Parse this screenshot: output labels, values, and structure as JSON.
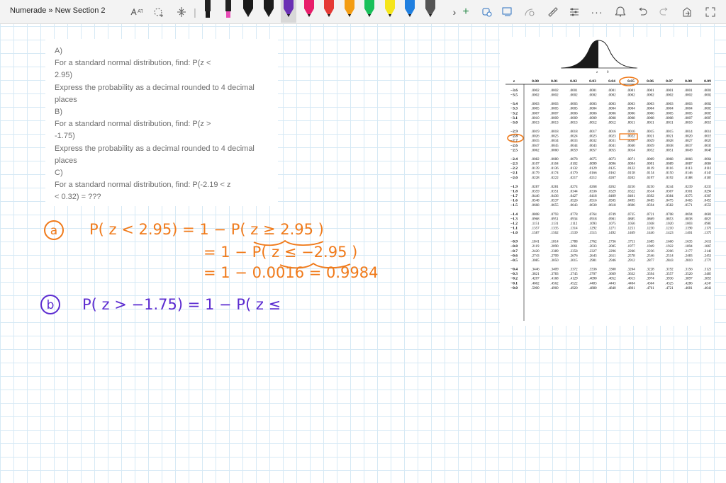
{
  "toolbar": {
    "breadcrumb": "Numerade » New Section 2",
    "tools": [
      "lasso-select-icon",
      "add-space-icon",
      "insert-space-icon"
    ],
    "pens": [
      {
        "name": "pen-black",
        "color": "#1a1a1a"
      },
      {
        "name": "highlighter-pink",
        "color": "#e84cb6"
      },
      {
        "name": "pen-black-2",
        "color": "#1a1a1a"
      },
      {
        "name": "pen-black-3",
        "color": "#1a1a1a"
      },
      {
        "name": "pen-purple",
        "color": "#6a2fb4"
      },
      {
        "name": "pen-pink",
        "color": "#e81d6a"
      },
      {
        "name": "pen-red",
        "color": "#e53935"
      },
      {
        "name": "pen-orange",
        "color": "#f39c12"
      },
      {
        "name": "pen-green",
        "color": "#18c05a"
      },
      {
        "name": "pen-yellow",
        "color": "#f5e51b"
      },
      {
        "name": "pen-blue",
        "color": "#1f7fe0"
      },
      {
        "name": "pen-grey",
        "color": "#555555"
      }
    ],
    "right_tools": [
      "add-pen-icon",
      "lasso-icon",
      "math-icon",
      "ink-to-shape-icon",
      "ruler-icon",
      "adjust-icon",
      "more-icon",
      "help-icon",
      "undo-icon",
      "redo-icon",
      "share-icon",
      "expand-icon"
    ]
  },
  "question": {
    "lines": [
      "A)",
      "For a standard normal distribution, find: P(z <",
      "2.95)",
      "Express the probability as a decimal rounded to 4 decimal",
      "places",
      "B)",
      "For a standard normal distribution, find: P(z >",
      "-1.75)",
      "Express the probability as a decimal rounded to 4 decimal",
      "places",
      "C)",
      "For a standard normal distribution, find: P(-2.19 < z",
      "< 0.32) = ???"
    ]
  },
  "ztable": {
    "curve_labels": [
      "z",
      "0"
    ],
    "headers": [
      "z",
      "0.00",
      "0.01",
      "0.02",
      "0.03",
      "0.04",
      "0.05",
      "0.06",
      "0.07",
      "0.08",
      "0.09"
    ],
    "groups": [
      [
        [
          "−3.6",
          ".0002",
          ".0002",
          ".0001",
          ".0001",
          ".0001",
          ".0001",
          ".0001",
          ".0001",
          ".0001",
          ".0001"
        ],
        [
          "−3.5",
          ".0002",
          ".0002",
          ".0002",
          ".0002",
          ".0002",
          ".0002",
          ".0002",
          ".0002",
          ".0002",
          ".0002"
        ]
      ],
      [
        [
          "−3.4",
          ".0003",
          ".0003",
          ".0003",
          ".0003",
          ".0003",
          ".0003",
          ".0003",
          ".0003",
          ".0003",
          ".0002"
        ],
        [
          "−3.3",
          ".0005",
          ".0005",
          ".0005",
          ".0004",
          ".0004",
          ".0004",
          ".0004",
          ".0004",
          ".0004",
          ".0003"
        ],
        [
          "−3.2",
          ".0007",
          ".0007",
          ".0006",
          ".0006",
          ".0006",
          ".0006",
          ".0006",
          ".0005",
          ".0005",
          ".0005"
        ],
        [
          "−3.1",
          ".0010",
          ".0009",
          ".0009",
          ".0009",
          ".0008",
          ".0008",
          ".0008",
          ".0008",
          ".0007",
          ".0007"
        ],
        [
          "−3.0",
          ".0013",
          ".0013",
          ".0013",
          ".0012",
          ".0012",
          ".0011",
          ".0011",
          ".0011",
          ".0010",
          ".0010"
        ]
      ],
      [
        [
          "−2.9",
          ".0019",
          ".0018",
          ".0018",
          ".0017",
          ".0016",
          ".0016",
          ".0015",
          ".0015",
          ".0014",
          ".0014"
        ],
        [
          "−2.8",
          ".0026",
          ".0025",
          ".0024",
          ".0023",
          ".0023",
          ".0022",
          ".0021",
          ".0021",
          ".0020",
          ".0019"
        ],
        [
          "−2.7",
          ".0035",
          ".0034",
          ".0033",
          ".0032",
          ".0031",
          ".0030",
          ".0029",
          ".0028",
          ".0027",
          ".0026"
        ],
        [
          "−2.6",
          ".0047",
          ".0045",
          ".0044",
          ".0043",
          ".0041",
          ".0040",
          ".0039",
          ".0038",
          ".0037",
          ".0036"
        ],
        [
          "−2.5",
          ".0062",
          ".0060",
          ".0059",
          ".0057",
          ".0055",
          ".0054",
          ".0052",
          ".0051",
          ".0049",
          ".0048"
        ]
      ],
      [
        [
          "−2.4",
          ".0082",
          ".0080",
          ".0078",
          ".0075",
          ".0073",
          ".0071",
          ".0069",
          ".0068",
          ".0066",
          ".0064"
        ],
        [
          "−2.3",
          ".0107",
          ".0104",
          ".0102",
          ".0099",
          ".0096",
          ".0094",
          ".0091",
          ".0089",
          ".0087",
          ".0084"
        ],
        [
          "−2.2",
          ".0139",
          ".0136",
          ".0132",
          ".0129",
          ".0125",
          ".0122",
          ".0119",
          ".0116",
          ".0113",
          ".0110"
        ],
        [
          "−2.1",
          ".0179",
          ".0174",
          ".0170",
          ".0166",
          ".0162",
          ".0158",
          ".0154",
          ".0150",
          ".0146",
          ".0143"
        ],
        [
          "−2.0",
          ".0228",
          ".0222",
          ".0217",
          ".0212",
          ".0207",
          ".0202",
          ".0197",
          ".0192",
          ".0188",
          ".0183"
        ]
      ],
      [
        [
          "−1.9",
          ".0287",
          ".0281",
          ".0274",
          ".0268",
          ".0262",
          ".0256",
          ".0250",
          ".0244",
          ".0239",
          ".0233"
        ],
        [
          "−1.8",
          ".0359",
          ".0351",
          ".0344",
          ".0336",
          ".0329",
          ".0322",
          ".0314",
          ".0307",
          ".0301",
          ".0294"
        ],
        [
          "−1.7",
          ".0446",
          ".0436",
          ".0427",
          ".0418",
          ".0409",
          ".0401",
          ".0392",
          ".0384",
          ".0375",
          ".0367"
        ],
        [
          "−1.6",
          ".0548",
          ".0537",
          ".0526",
          ".0516",
          ".0505",
          ".0495",
          ".0485",
          ".0475",
          ".0465",
          ".0455"
        ],
        [
          "−1.5",
          ".0668",
          ".0655",
          ".0643",
          ".0630",
          ".0618",
          ".0606",
          ".0594",
          ".0582",
          ".0571",
          ".0559"
        ]
      ],
      [
        [
          "−1.4",
          ".0808",
          ".0793",
          ".0778",
          ".0764",
          ".0749",
          ".0735",
          ".0721",
          ".0708",
          ".0694",
          ".0681"
        ],
        [
          "−1.3",
          ".0968",
          ".0951",
          ".0934",
          ".0918",
          ".0901",
          ".0885",
          ".0869",
          ".0853",
          ".0838",
          ".0823"
        ],
        [
          "−1.2",
          ".1151",
          ".1131",
          ".1112",
          ".1093",
          ".1075",
          ".1056",
          ".1038",
          ".1020",
          ".1003",
          ".0985"
        ],
        [
          "−1.1",
          ".1357",
          ".1335",
          ".1314",
          ".1292",
          ".1271",
          ".1251",
          ".1230",
          ".1210",
          ".1190",
          ".1170"
        ],
        [
          "−1.0",
          ".1587",
          ".1562",
          ".1539",
          ".1515",
          ".1492",
          ".1469",
          ".1446",
          ".1423",
          ".1401",
          ".1379"
        ]
      ],
      [
        [
          "−0.9",
          ".1841",
          ".1814",
          ".1788",
          ".1762",
          ".1736",
          ".1711",
          ".1685",
          ".1660",
          ".1635",
          ".1611"
        ],
        [
          "−0.8",
          ".2119",
          ".2090",
          ".2061",
          ".2033",
          ".2005",
          ".1977",
          ".1949",
          ".1922",
          ".1894",
          ".1867"
        ],
        [
          "−0.7",
          ".2420",
          ".2389",
          ".2358",
          ".2327",
          ".2296",
          ".2266",
          ".2236",
          ".2206",
          ".2177",
          ".2148"
        ],
        [
          "−0.6",
          ".2743",
          ".2709",
          ".2676",
          ".2643",
          ".2611",
          ".2578",
          ".2546",
          ".2514",
          ".2483",
          ".2451"
        ],
        [
          "−0.5",
          ".3085",
          ".3050",
          ".3015",
          ".2981",
          ".2946",
          ".2912",
          ".2877",
          ".2843",
          ".2810",
          ".2776"
        ]
      ],
      [
        [
          "−0.4",
          ".3446",
          ".3409",
          ".3372",
          ".3336",
          ".3300",
          ".3264",
          ".3228",
          ".3192",
          ".3156",
          ".3121"
        ],
        [
          "−0.3",
          ".3821",
          ".3783",
          ".3745",
          ".3707",
          ".3669",
          ".3632",
          ".3594",
          ".3557",
          ".3520",
          ".3483"
        ],
        [
          "−0.2",
          ".4207",
          ".4168",
          ".4129",
          ".4090",
          ".4052",
          ".4013",
          ".3974",
          ".3936",
          ".3897",
          ".3859"
        ],
        [
          "−0.1",
          ".4602",
          ".4562",
          ".4522",
          ".4483",
          ".4443",
          ".4404",
          ".4364",
          ".4325",
          ".4286",
          ".4247"
        ],
        [
          "−0.0",
          ".5000",
          ".4960",
          ".4920",
          ".4880",
          ".4840",
          ".4801",
          ".4761",
          ".4721",
          ".4681",
          ".4641"
        ]
      ]
    ]
  },
  "handwriting": {
    "a_label": "a",
    "a_line1": "P( z < 2.95) = 1 − P( z ≥ 2.95 )",
    "a_line2": "= 1 − P( z ≤ −2.95 )",
    "a_line3": "= 1 − 0.0016 = 0.9984",
    "b_label": "b",
    "b_line1": "P( z > −1.75) = 1 − P( z ≤"
  },
  "colors": {
    "ink_orange": "#f07a1a",
    "ink_purple": "#5b2bd0",
    "grid": "#d6e9f5",
    "table_fill": "#111111"
  }
}
